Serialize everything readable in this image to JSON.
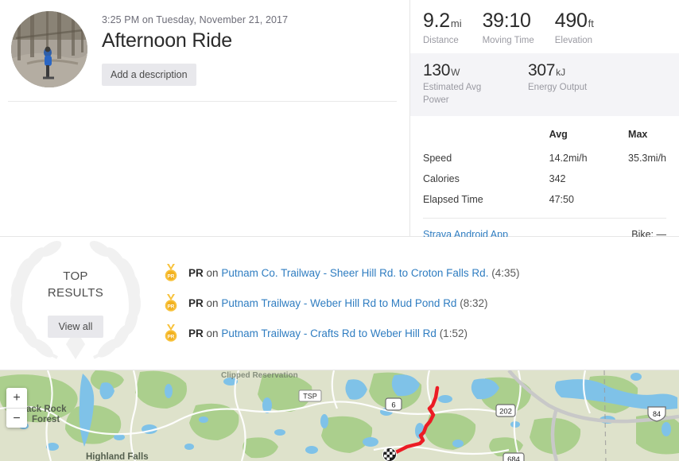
{
  "activity": {
    "date": "3:25 PM on Tuesday, November 21, 2017",
    "title": "Afternoon Ride",
    "description_button": "Add a description"
  },
  "primary_stats": [
    {
      "value": "9.2",
      "unit": "mi",
      "label": "Distance"
    },
    {
      "value": "39:10",
      "unit": "",
      "label": "Moving Time"
    },
    {
      "value": "490",
      "unit": "ft",
      "label": "Elevation"
    }
  ],
  "power_stats": [
    {
      "value": "130",
      "unit": "W",
      "label": "Estimated Avg Power"
    },
    {
      "value": "307",
      "unit": "kJ",
      "label": "Energy Output"
    }
  ],
  "detail_table": {
    "headers": {
      "metric": "",
      "avg": "Avg",
      "max": "Max"
    },
    "rows": [
      {
        "metric": "Speed",
        "avg": "14.2mi/h",
        "max": "35.3mi/h"
      },
      {
        "metric": "Calories",
        "avg": "342",
        "max": ""
      },
      {
        "metric": "Elapsed Time",
        "avg": "47:50",
        "max": ""
      }
    ]
  },
  "stats_footer": {
    "app_link": "Strava Android App",
    "bike": "Bike: —"
  },
  "top_results": {
    "title_line1": "TOP",
    "title_line2": "RESULTS",
    "view_all": "View all",
    "items": [
      {
        "badge": "PR",
        "prefix": "PR",
        "on": "on",
        "segment": "Putnam Co. Trailway - Sheer Hill Rd. to Croton Falls Rd.",
        "time": "(4:35)"
      },
      {
        "badge": "PR",
        "prefix": "PR",
        "on": "on",
        "segment": "Putnam Trailway - Weber Hill Rd to Mud Pond Rd",
        "time": "(8:32)"
      },
      {
        "badge": "PR",
        "prefix": "PR",
        "on": "on",
        "segment": "Putnam Trailway - Crafts Rd to Weber Hill Rd",
        "time": "(1:52)"
      }
    ]
  },
  "map": {
    "zoom_in": "+",
    "zoom_out": "−",
    "place_labels": [
      "Black Rock Forest",
      "Highland Falls"
    ],
    "route_shields": [
      "TSP",
      "6",
      "202",
      "84",
      "684"
    ],
    "route_color": "#ec1c24"
  },
  "colors": {
    "link": "#2f7dc1",
    "medal_gold": "#f8c23b",
    "panel_gray": "#f4f4f7",
    "route_red": "#ec1c24"
  }
}
